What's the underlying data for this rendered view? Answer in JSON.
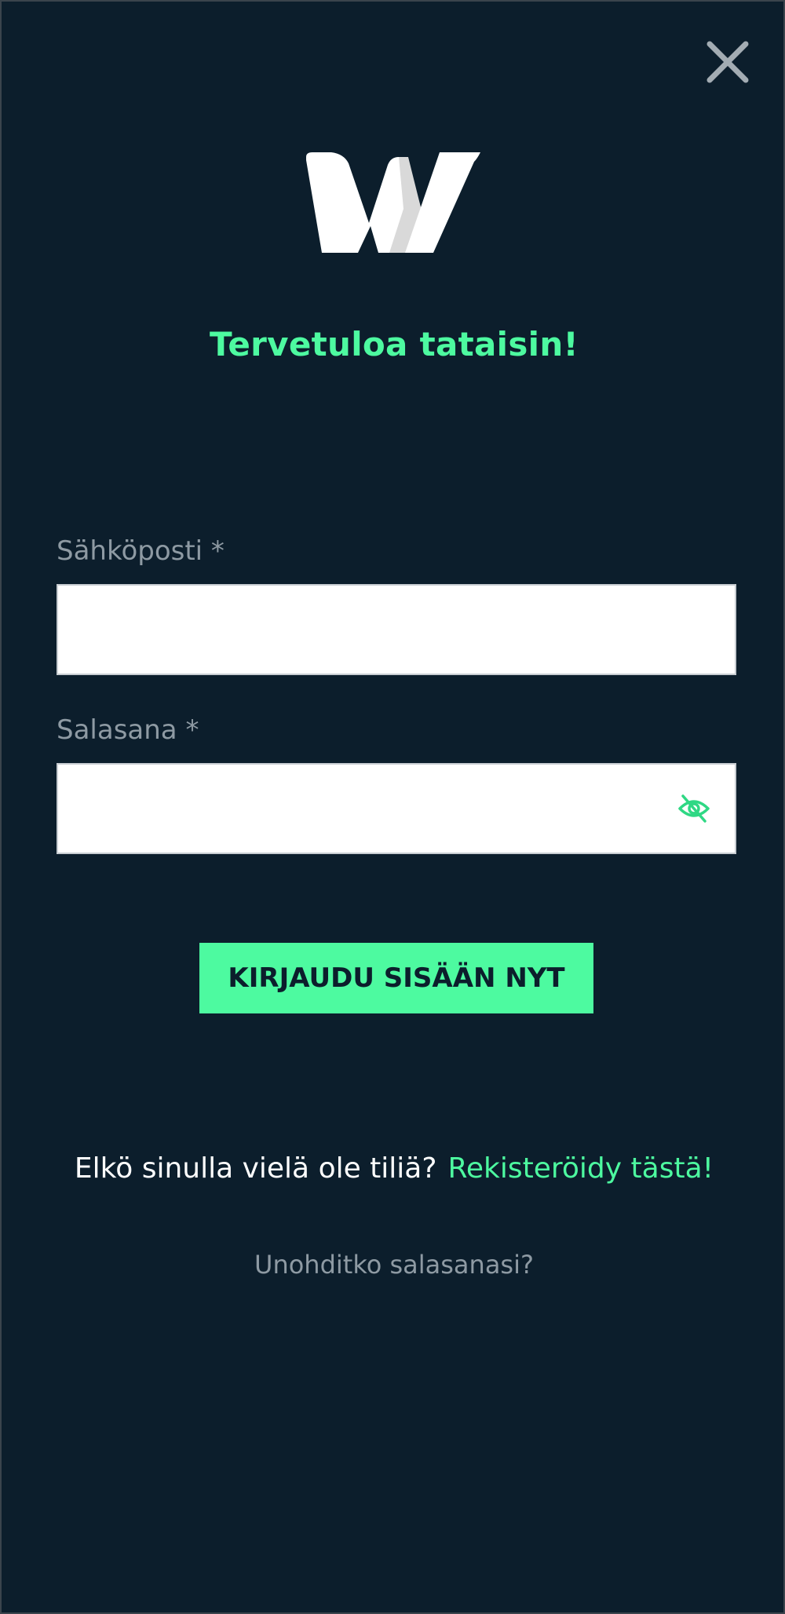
{
  "header": {
    "close_icon": "close-icon",
    "logo_icon": "brand-w-logo"
  },
  "welcome": {
    "title": "Tervetuloa tataisin!"
  },
  "form": {
    "email": {
      "label": "Sähköposti *",
      "value": "",
      "placeholder": ""
    },
    "password": {
      "label": "Salasana *",
      "value": "",
      "placeholder": "",
      "toggle_icon": "eye-slash-icon"
    },
    "submit_label": "KIRJAUDU SISÄÄN NYT"
  },
  "footer": {
    "register_prompt": "Elkö sinulla vielä ole tiliä?",
    "register_link": "Rekisteröidy tästä!",
    "forgot_password": "Unohditko salasanasi?"
  },
  "colors": {
    "background": "#0c1e2c",
    "accent": "#4dfaa0",
    "muted_text": "#8e9aa3",
    "white": "#ffffff"
  }
}
